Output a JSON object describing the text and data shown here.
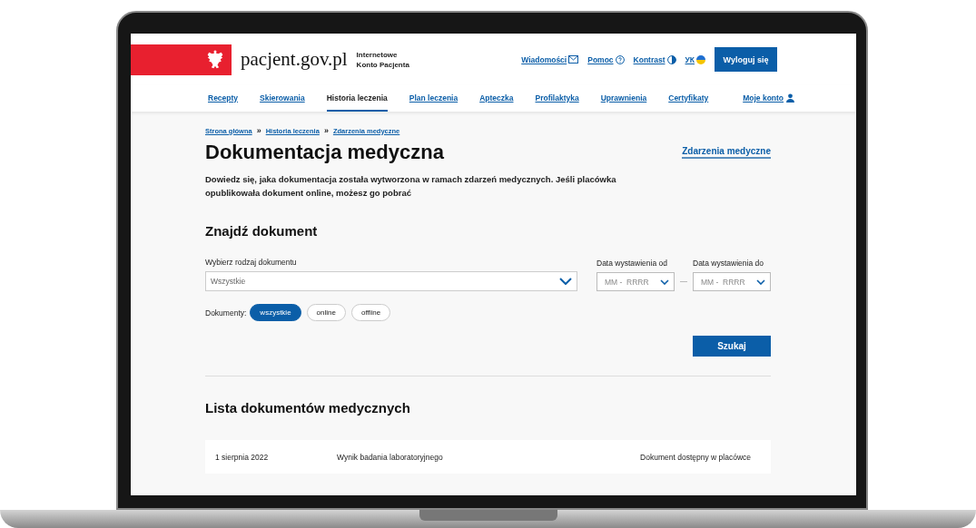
{
  "header": {
    "logo": "pacjent.gov.pl",
    "subtitle_lines": [
      "Internetowe",
      "Konto Pacjenta"
    ],
    "links": [
      {
        "label": "Wiadomości",
        "kind": "mail"
      },
      {
        "label": "Pomoc",
        "kind": "help"
      },
      {
        "label": "Kontrast",
        "kind": "contrast"
      },
      {
        "label": "УК",
        "kind": "flag"
      }
    ],
    "logout": "Wyloguj się"
  },
  "nav": [
    {
      "label": "Recepty",
      "selected": false,
      "kind": "link"
    },
    {
      "label": "Skierowania",
      "selected": false,
      "kind": "link"
    },
    {
      "label": "Historia leczenia",
      "selected": true,
      "kind": "link"
    },
    {
      "label": "Plan leczenia",
      "selected": false,
      "kind": "link"
    },
    {
      "label": "Apteczka",
      "selected": false,
      "kind": "link"
    },
    {
      "label": "Profilaktyka",
      "selected": false,
      "kind": "link"
    },
    {
      "label": "Uprawnienia",
      "selected": false,
      "kind": "link"
    },
    {
      "label": "Certyfikaty",
      "selected": false,
      "kind": "link"
    },
    {
      "label": "Moje konto",
      "selected": false,
      "kind": "account"
    }
  ],
  "breadcrumb": {
    "items": [
      "Strona główna",
      "Historia leczenia",
      "Zdarzenia medyczne"
    ],
    "separator": "»"
  },
  "title": "Dokumentacja medyczna",
  "side_link": "Zdarzenia medyczne",
  "description": "Dowiedz się, jaka dokumentacja została wytworzona w ramach zdarzeń medycznych. Jeśli placówka opublikowała dokument online, możesz go pobrać",
  "search": {
    "heading": "Znajdź dokument",
    "type_label": "Wybierz rodzaj dokumentu",
    "type_value": "Wszystkie",
    "dates": [
      {
        "label": "Data wystawienia od",
        "placeholder": "MM -  RRRR"
      },
      {
        "label": "Data wystawienia do",
        "placeholder": "MM -  RRRR"
      }
    ],
    "filter_label": "Dokumenty:",
    "filters": [
      {
        "label": "wszystkie",
        "selected": true
      },
      {
        "label": "online",
        "selected": false
      },
      {
        "label": "offline",
        "selected": false
      }
    ],
    "button": "Szukaj"
  },
  "list": {
    "heading": "Lista dokumentów medycznych",
    "rows": [
      {
        "date": "1 sierpnia 2022",
        "type": "Wynik badania laboratoryjnego",
        "status": "Dokument dostępny w placówce"
      }
    ]
  }
}
